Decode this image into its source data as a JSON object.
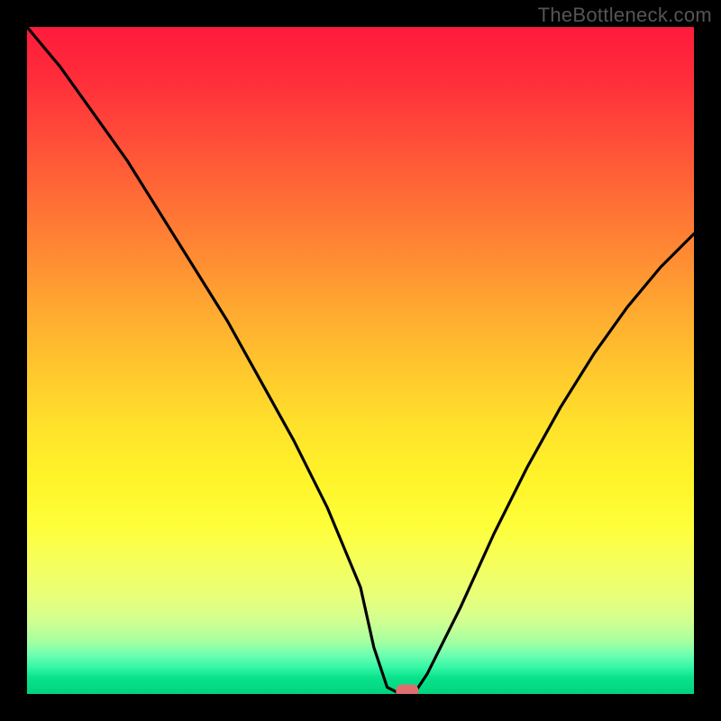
{
  "watermark": "TheBottleneck.com",
  "chart_data": {
    "type": "line",
    "title": "",
    "xlabel": "",
    "ylabel": "",
    "xlim": [
      0,
      100
    ],
    "ylim": [
      0,
      100
    ],
    "grid": false,
    "x": [
      0,
      5,
      10,
      15,
      20,
      25,
      30,
      35,
      40,
      45,
      50,
      52,
      54,
      56,
      58,
      60,
      65,
      70,
      75,
      80,
      85,
      90,
      95,
      100
    ],
    "values": [
      100,
      94,
      87,
      80,
      72,
      64,
      56,
      47,
      38,
      28,
      16,
      7,
      1,
      0,
      0,
      3,
      13,
      24,
      34,
      43,
      51,
      58,
      64,
      69
    ],
    "marker": {
      "x": 57,
      "y": 0,
      "shape": "pill",
      "color": "#e06e6e"
    },
    "background_gradient": {
      "orientation": "vertical",
      "stops": [
        {
          "pos": 0.0,
          "color": "#ff1a3c"
        },
        {
          "pos": 0.25,
          "color": "#ff6a36"
        },
        {
          "pos": 0.5,
          "color": "#ffc92d"
        },
        {
          "pos": 0.75,
          "color": "#feff3a"
        },
        {
          "pos": 0.95,
          "color": "#34f7a6"
        },
        {
          "pos": 1.0,
          "color": "#00d47d"
        }
      ]
    }
  }
}
